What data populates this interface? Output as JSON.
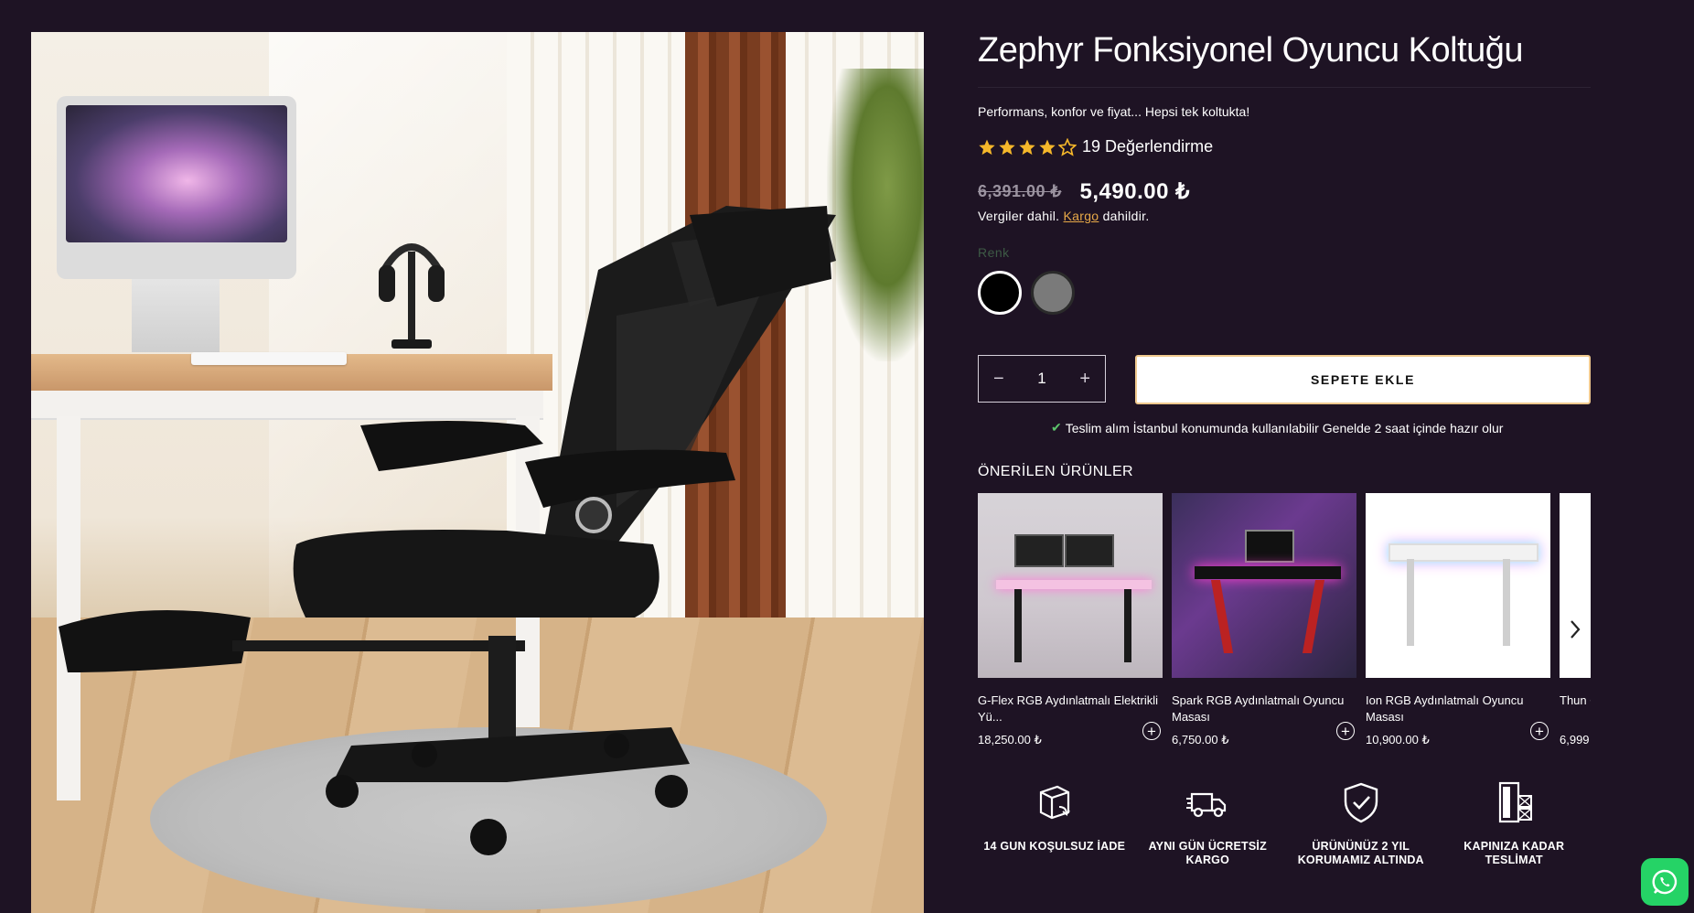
{
  "product": {
    "title": "Zephyr Fonksiyonel Oyuncu Koltuğu",
    "tagline": "Performans, konfor ve fiyat... Hepsi tek koltukta!",
    "rating_stars": 4,
    "rating_text": "19 Değerlendirme",
    "old_price": "6,391.00 ₺",
    "new_price": "5,490.00 ₺",
    "tax_prefix": "Vergiler dahil.",
    "shipping_link": "Kargo",
    "tax_suffix": "dahildir.",
    "color_label": "Renk",
    "colors": [
      {
        "name": "Siyah",
        "hex": "#000000",
        "selected": true
      },
      {
        "name": "Gri",
        "hex": "#7a7a7a",
        "selected": false
      }
    ],
    "quantity": "1",
    "minus": "−",
    "plus": "+",
    "add_to_cart": "SEPETE EKLE",
    "pickup_available": "Teslim alım İstanbul konumunda kullanılabilir",
    "pickup_time": "Genelde 2 saat içinde hazır olur"
  },
  "recommendations": {
    "title": "ÖNERİLEN ÜRÜNLER",
    "items": [
      {
        "name": "G-Flex RGB Aydınlatmalı Elektrikli Yü...",
        "price": "18,250.00 ₺"
      },
      {
        "name": "Spark RGB Aydınlatmalı Oyuncu Masası",
        "price": "6,750.00 ₺"
      },
      {
        "name": "Ion RGB Aydınlatmalı Oyuncu Masası",
        "price": "10,900.00 ₺"
      },
      {
        "name": "Thun Oyun",
        "price": "6,999"
      }
    ],
    "next_icon": "chevron-right-icon"
  },
  "features": [
    {
      "icon": "box-return-icon",
      "text": "14 GUN KOŞULSUZ İADE"
    },
    {
      "icon": "truck-icon",
      "text": "AYNI GÜN ÜCRETSİZ KARGO"
    },
    {
      "icon": "shield-check-icon",
      "text": "ÜRÜNÜNÜZ 2 YIL KORUMAMIZ ALTINDA"
    },
    {
      "icon": "door-delivery-icon",
      "text": "KAPINIZA KADAR TESLİMAT"
    }
  ],
  "colors": {
    "background": "#1e1324",
    "accent_link": "#e8a948",
    "star": "#f5b72a",
    "whatsapp": "#25d366"
  }
}
